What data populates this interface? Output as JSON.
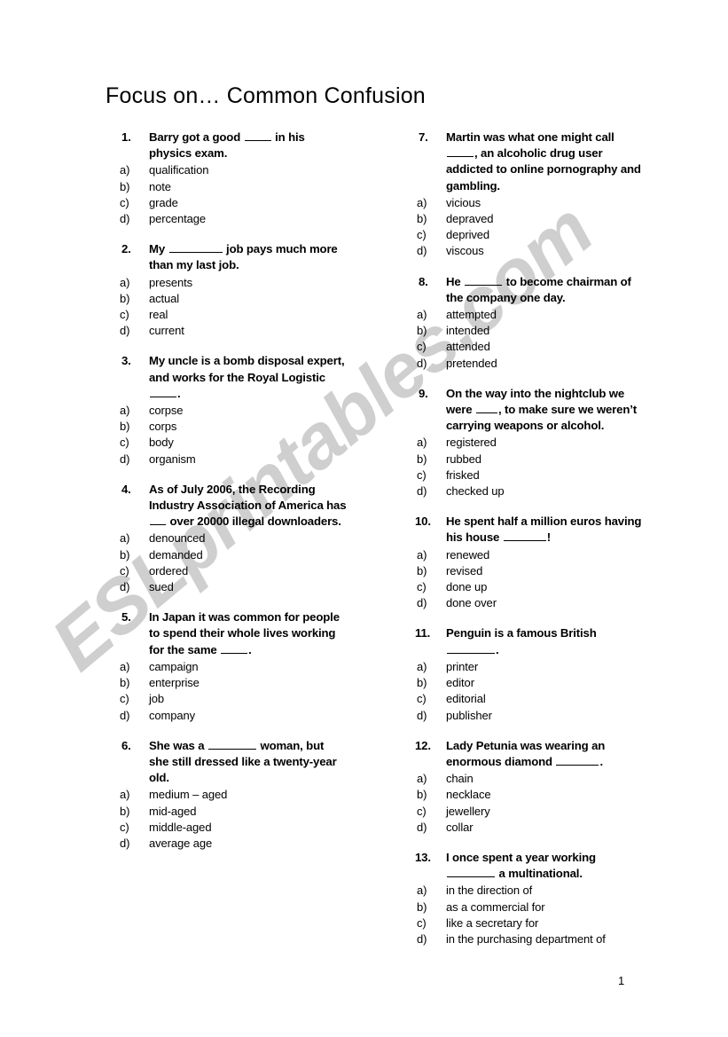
{
  "document": {
    "title": "Focus on… Common Confusion",
    "page_number": "1",
    "watermark": "ESLprintables.com",
    "watermark_color": "#cccccc"
  },
  "columns": [
    {
      "name": "left-column",
      "questions": [
        {
          "number": "1.",
          "stem": "Barry got a good _____ in his physics exam.",
          "stem_lines": [
            "Barry got a good _____ in his",
            "physics exam."
          ],
          "options": [
            {
              "letter": "a)",
              "text": "qualification"
            },
            {
              "letter": "b)",
              "text": "note"
            },
            {
              "letter": "c)",
              "text": "grade"
            },
            {
              "letter": "d)",
              "text": "percentage"
            }
          ]
        },
        {
          "number": "2.",
          "stem": "My __________ job pays much more than my last job.",
          "stem_lines": [
            "My __________ job pays much more",
            "than my last job."
          ],
          "options": [
            {
              "letter": "a)",
              "text": "presents"
            },
            {
              "letter": "b)",
              "text": "actual"
            },
            {
              "letter": "c)",
              "text": "real"
            },
            {
              "letter": "d)",
              "text": "current"
            }
          ]
        },
        {
          "number": "3.",
          "stem": "My uncle is a bomb disposal expert, and works for the Royal Logistic _____.",
          "stem_lines": [
            "My uncle is a bomb disposal expert,",
            "and works for the Royal Logistic",
            "_____."
          ],
          "options": [
            {
              "letter": "a)",
              "text": "corpse"
            },
            {
              "letter": "b)",
              "text": "corps"
            },
            {
              "letter": "c)",
              "text": "body"
            },
            {
              "letter": "d)",
              "text": "organism"
            }
          ]
        },
        {
          "number": "4.",
          "stem": "As of July 2006, the Recording Industry Association of America has ___ over 20000 illegal downloaders.",
          "stem_lines": [
            "As of July 2006, the Recording",
            "Industry Association of America has",
            "___ over 20000 illegal downloaders."
          ],
          "options": [
            {
              "letter": "a)",
              "text": "denounced"
            },
            {
              "letter": "b)",
              "text": "demanded"
            },
            {
              "letter": "c)",
              "text": "ordered"
            },
            {
              "letter": "d)",
              "text": "sued"
            }
          ]
        },
        {
          "number": "5.",
          "stem": "In Japan it was common for people to spend their whole lives working for the same _____.",
          "stem_lines": [
            "In Japan it was common for people",
            "to spend their whole lives working",
            "for the same _____."
          ],
          "options": [
            {
              "letter": "a)",
              "text": "campaign"
            },
            {
              "letter": "b)",
              "text": "enterprise"
            },
            {
              "letter": "c)",
              "text": "job"
            },
            {
              "letter": "d)",
              "text": "company"
            }
          ]
        },
        {
          "number": "6.",
          "stem": "She was a _________ woman, but she still dressed like a twenty-year old.",
          "stem_lines": [
            "She was a _________ woman, but",
            "she still dressed like a twenty-year",
            "old."
          ],
          "options": [
            {
              "letter": "a)",
              "text": "medium – aged"
            },
            {
              "letter": "b)",
              "text": "mid-aged"
            },
            {
              "letter": "c)",
              "text": "middle-aged"
            },
            {
              "letter": "d)",
              "text": "average age"
            }
          ]
        }
      ]
    },
    {
      "name": "right-column",
      "questions": [
        {
          "number": "7.",
          "stem": "Martin was what one might call _____, an alcoholic drug user addicted to online pornography and gambling.",
          "stem_lines": [
            "Martin was what one might call",
            "_____, an alcoholic drug user",
            "addicted to online pornography and",
            "gambling."
          ],
          "options": [
            {
              "letter": "a)",
              "text": "vicious"
            },
            {
              "letter": "b)",
              "text": "depraved"
            },
            {
              "letter": "c)",
              "text": "deprived"
            },
            {
              "letter": "d)",
              "text": "viscous"
            }
          ]
        },
        {
          "number": "8.",
          "stem": "He _______ to become chairman of the company one day.",
          "stem_lines": [
            "He _______ to become chairman of",
            "the company one day."
          ],
          "options": [
            {
              "letter": "a)",
              "text": "attempted"
            },
            {
              "letter": "b)",
              "text": "intended"
            },
            {
              "letter": "c)",
              "text": "attended"
            },
            {
              "letter": "d)",
              "text": "pretended"
            }
          ]
        },
        {
          "number": "9.",
          "stem": "On the way into the nightclub we were ____, to make sure we weren't carrying weapons or alcohol.",
          "stem_lines": [
            "On the way into the nightclub we",
            "were ____, to make sure we weren’t",
            "carrying weapons or alcohol."
          ],
          "options": [
            {
              "letter": "a)",
              "text": "registered"
            },
            {
              "letter": "b)",
              "text": "rubbed"
            },
            {
              "letter": "c)",
              "text": "frisked"
            },
            {
              "letter": "d)",
              "text": "checked up"
            }
          ]
        },
        {
          "number": "10.",
          "stem": "He spent half a million euros having his house ________!",
          "stem_lines": [
            "He spent half a million euros having",
            "his house ________!"
          ],
          "options": [
            {
              "letter": "a)",
              "text": "renewed"
            },
            {
              "letter": "b)",
              "text": "revised"
            },
            {
              "letter": "c)",
              "text": "done up"
            },
            {
              "letter": "d)",
              "text": "done over"
            }
          ]
        },
        {
          "number": "11.",
          "stem": "Penguin is a famous British _________.",
          "stem_lines": [
            "Penguin is a famous British",
            "_________."
          ],
          "options": [
            {
              "letter": "a)",
              "text": "printer"
            },
            {
              "letter": "b)",
              "text": "editor"
            },
            {
              "letter": "c)",
              "text": "editorial"
            },
            {
              "letter": "d)",
              "text": "publisher"
            }
          ]
        },
        {
          "number": "12.",
          "stem": "Lady Petunia was wearing an enormous diamond ________.",
          "stem_lines": [
            "Lady Petunia was wearing an",
            "enormous diamond ________."
          ],
          "options": [
            {
              "letter": "a)",
              "text": "chain"
            },
            {
              "letter": "b)",
              "text": "necklace"
            },
            {
              "letter": "c)",
              "text": "jewellery"
            },
            {
              "letter": "d)",
              "text": "collar"
            }
          ]
        },
        {
          "number": "13.",
          "stem": "I once spent a year working _________ a multinational.",
          "stem_lines": [
            "I once spent a year working",
            "_________ a multinational."
          ],
          "options": [
            {
              "letter": "a)",
              "text": "in the direction of"
            },
            {
              "letter": "b)",
              "text": "as a commercial for"
            },
            {
              "letter": "c)",
              "text": "like a secretary for"
            },
            {
              "letter": "d)",
              "text": "in the purchasing department of"
            }
          ]
        }
      ]
    }
  ]
}
